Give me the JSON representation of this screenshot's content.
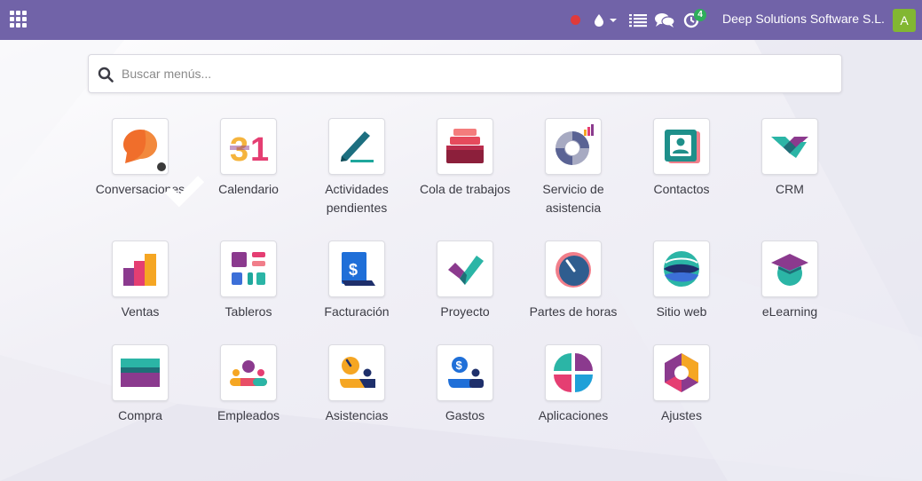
{
  "topbar": {
    "company": "Deep Solutions Software S.L.",
    "avatar_letter": "A",
    "activity_count": "4",
    "bg_color": "#7163a8"
  },
  "search": {
    "placeholder": "Buscar menús..."
  },
  "apps": [
    {
      "label": "Conversaciones",
      "icon": "chat-bubble-icon"
    },
    {
      "label": "Calendario",
      "icon": "calendar-31-icon"
    },
    {
      "label": "Actividades pendientes",
      "icon": "pen-icon"
    },
    {
      "label": "Cola de trabajos",
      "icon": "stack-icon"
    },
    {
      "label": "Servicio de asistencia",
      "icon": "lifebuoy-icon"
    },
    {
      "label": "Contactos",
      "icon": "contact-card-icon"
    },
    {
      "label": "CRM",
      "icon": "handshake-icon"
    },
    {
      "label": "Ventas",
      "icon": "bar-chart-icon"
    },
    {
      "label": "Tableros",
      "icon": "dashboard-icon"
    },
    {
      "label": "Facturación",
      "icon": "invoice-dollar-icon"
    },
    {
      "label": "Proyecto",
      "icon": "checkmark-icon"
    },
    {
      "label": "Partes de horas",
      "icon": "gauge-icon"
    },
    {
      "label": "Sitio web",
      "icon": "globe-icon"
    },
    {
      "label": "eLearning",
      "icon": "graduation-cap-icon"
    },
    {
      "label": "Compra",
      "icon": "credit-card-icon"
    },
    {
      "label": "Empleados",
      "icon": "people-icon"
    },
    {
      "label": "Asistencias",
      "icon": "clock-person-icon"
    },
    {
      "label": "Gastos",
      "icon": "expense-icon"
    },
    {
      "label": "Aplicaciones",
      "icon": "apps-pinwheel-icon"
    },
    {
      "label": "Ajustes",
      "icon": "gear-hexagon-icon"
    }
  ]
}
